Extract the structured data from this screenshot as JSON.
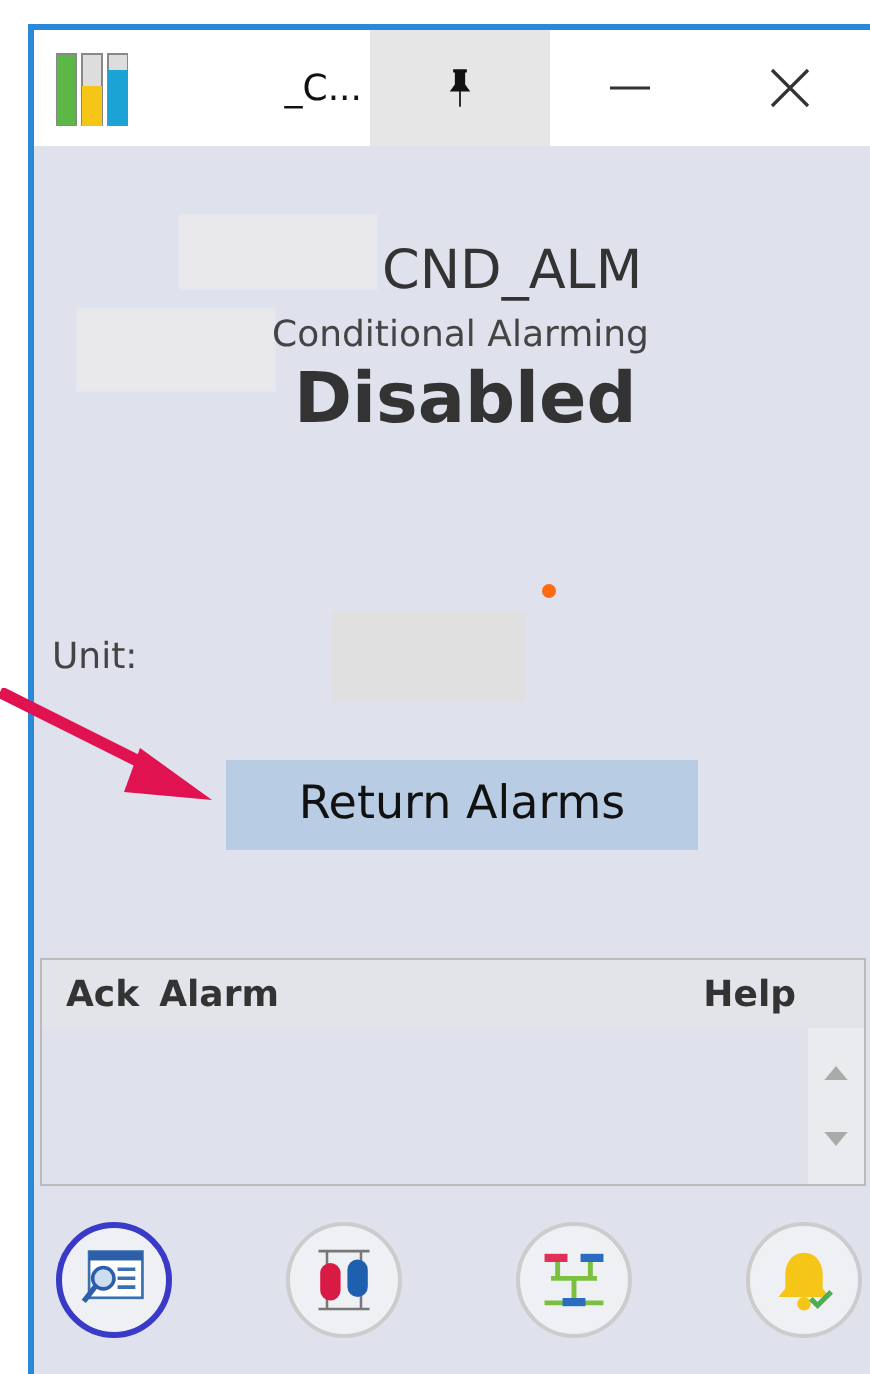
{
  "window": {
    "title": "_C..."
  },
  "header": {
    "tag": "CND_ALM",
    "description": "Conditional Alarming",
    "status": "Disabled"
  },
  "unit": {
    "label": "Unit:"
  },
  "return_button": {
    "label": "Return Alarms"
  },
  "alarm_list": {
    "columns": [
      "Ack",
      "Alarm",
      "Help"
    ]
  },
  "toolbar": [
    {
      "kind": "viewer",
      "selected": true
    },
    {
      "kind": "tanks",
      "selected": false
    },
    {
      "kind": "network",
      "selected": false
    },
    {
      "kind": "bell",
      "selected": false
    }
  ]
}
